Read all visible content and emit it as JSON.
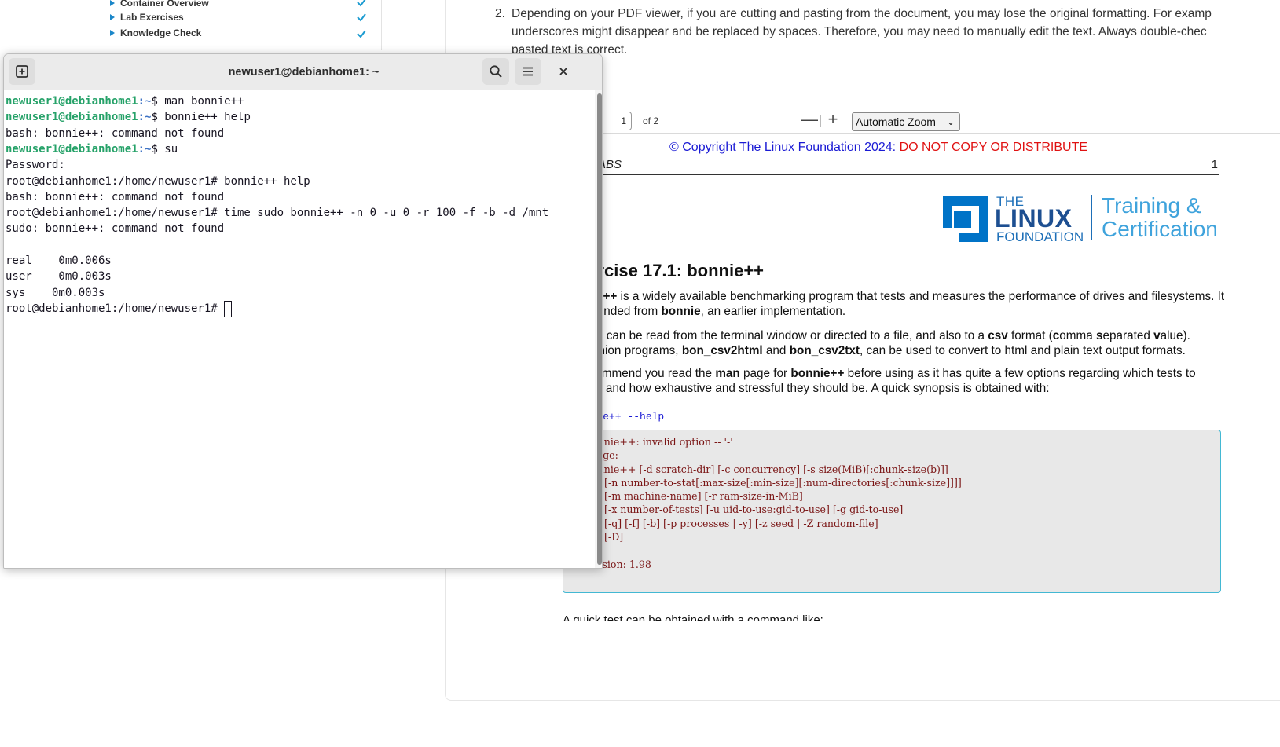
{
  "sidebar": {
    "items": [
      {
        "label": "Container Overview",
        "checked": true
      },
      {
        "label": "Lab Exercises",
        "checked": true
      },
      {
        "label": "Knowledge Check",
        "checked": true
      }
    ]
  },
  "note": {
    "number": "2.",
    "lines": [
      "Depending on your PDF viewer, if you are cutting and pasting from the document, you may lose the original formatting. For examp",
      "underscores might disappear and be replaced by spaces. Therefore, you may need to manually edit the text. Always double-chec",
      "pasted text is correct."
    ]
  },
  "pdf": {
    "toolbar": {
      "page_value": "1",
      "page_of": "of 2",
      "zoom_out": "—",
      "zoom_in": "+",
      "zoom_value": "Automatic Zoom"
    },
    "copyright_blue": "© Copyright The Linux Foundation 2024:",
    "copyright_red": "DO NOT COPY OR DISTRIBUTE",
    "section": "4.  LABS",
    "page_number": "1",
    "logo": {
      "the": "THE",
      "linux": "LINUX",
      "foundation": "FOUNDATION",
      "training_line1": "Training &",
      "training_line2": "Certification"
    },
    "exercise_title": "xercise 17.1: bonnie++",
    "p1_bold": "nnie++",
    "p1_text": " is a widely available benchmarking program that tests and measures the performance of drives and filesystems. It",
    "p1_line2_a": "escended from ",
    "p1_line2_bold": "bonnie",
    "p1_line2_b": ", an earlier implementation.",
    "p2_a": "sults can be read from the terminal window or directed to a file, and also to a ",
    "p2_csv": "csv",
    "p2_b": " format (",
    "p2_c": "c",
    "p2_d": "omma ",
    "p2_s": "s",
    "p2_e": "eparated ",
    "p2_v": "v",
    "p2_f": "alue).",
    "p2_line2_a": "npanion programs, ",
    "p2_line2_b1": "bon_csv2html",
    "p2_line2_and": " and ",
    "p2_line2_b2": "bon_csv2txt",
    "p2_line2_c": ", can be used to convert to html and plain text output formats.",
    "p3_a": " recommend you read the ",
    "p3_man": "man",
    "p3_b": " page for ",
    "p3_bonnie": "bonnie++",
    "p3_c": " before using as it has quite a few options regarding which tests to",
    "p3_line2": "form and how exhaustive and stressful they should be. A quick synopsis is obtained with:",
    "command": "onnie++ --help",
    "code_block": "bonnie++: invalid option -- '-'\nusage:\nbonnie++ [-d scratch-dir] [-c concurrency] [-s size(MiB)[:chunk-size(b)]]\n      [-n number-to-stat[:max-size[:min-size][:num-directories[:chunk-size]]]]\n      [-m machine-name] [-r ram-size-in-MiB]\n      [-x number-of-tests] [-u uid-to-use:gid-to-use] [-g gid-to-use]\n      [-q] [-f] [-b] [-p processes | -y] [-z seed | -Z random-file]\n      [-D]\n\nVersion: 1.98",
    "quick_test": "A quick test can be obtained with a command like:"
  },
  "terminal": {
    "title": "newuser1@debianhome1: ~",
    "lines": [
      {
        "user": "newuser1@debianhome1",
        "path": ":~",
        "rest": "$ man bonnie++"
      },
      {
        "user": "newuser1@debianhome1",
        "path": ":~",
        "rest": "$ bonnie++ help"
      },
      {
        "text": "bash: bonnie++: command not found"
      },
      {
        "user": "newuser1@debianhome1",
        "path": ":~",
        "rest": "$ su"
      },
      {
        "text": "Password:"
      },
      {
        "text": "root@debianhome1:/home/newuser1# bonnie++ help"
      },
      {
        "text": "bash: bonnie++: command not found"
      },
      {
        "text": "root@debianhome1:/home/newuser1# time sudo bonnie++ -n 0 -u 0 -r 100 -f -b -d /mnt"
      },
      {
        "text": "sudo: bonnie++: command not found"
      },
      {
        "text": ""
      },
      {
        "text": "real\t0m0.006s"
      },
      {
        "text": "user\t0m0.003s"
      },
      {
        "text": "sys\t0m0.003s"
      },
      {
        "text": "root@debianhome1:/home/newuser1# ",
        "cursor": true
      }
    ]
  },
  "colors": {
    "prompt_user": "#26a269",
    "prompt_path": "#3d72c4",
    "accent_blue": "#1a1ad4",
    "warning_red": "#e01212",
    "code_border": "#43b8d3"
  }
}
